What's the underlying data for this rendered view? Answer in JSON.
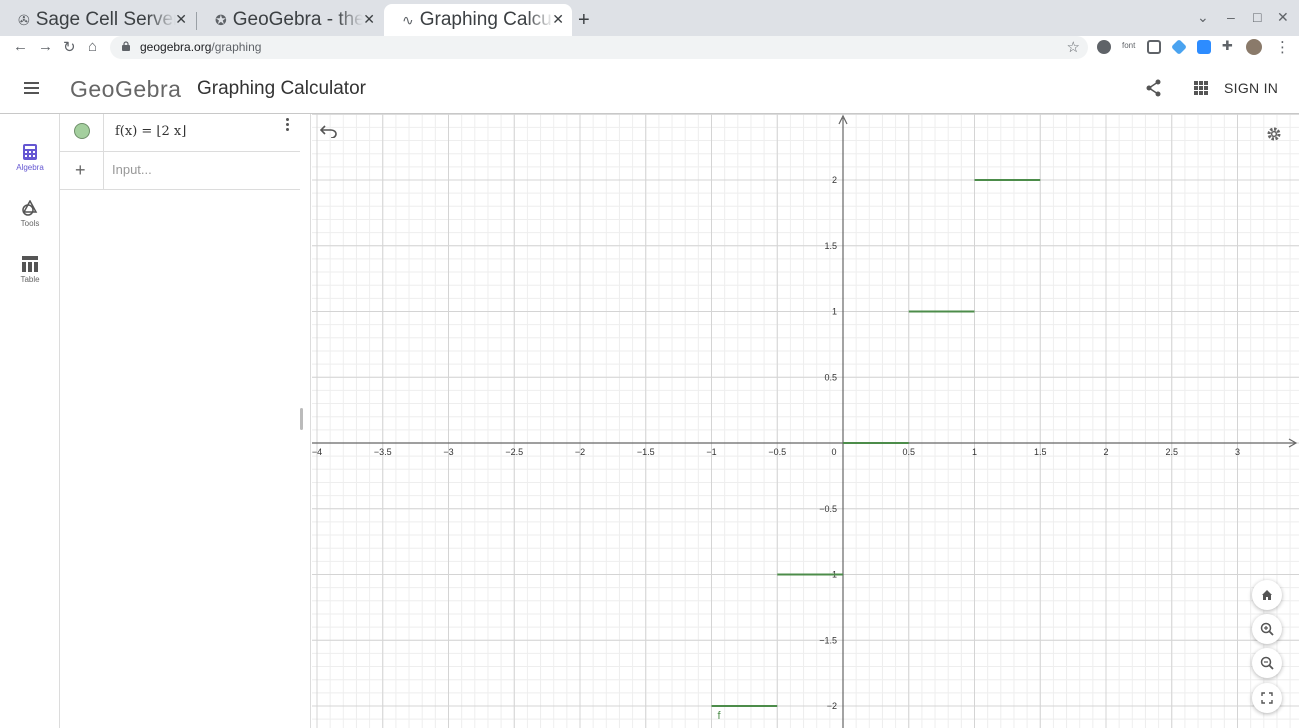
{
  "browser": {
    "tabs": [
      {
        "title": "Sage Cell Server",
        "icon": "sage-icon",
        "active": false
      },
      {
        "title": "GeoGebra - the world",
        "icon": "geogebra-icon",
        "active": false
      },
      {
        "title": "Graphing Calculator",
        "icon": "geogebra-graphing-icon",
        "active": true
      }
    ],
    "url_host": "geogebra.org",
    "url_path": "/graphing",
    "extension_labels": [
      "font"
    ]
  },
  "header": {
    "logo": "GeoGebra",
    "title": "Graphing Calculator",
    "sign_in": "SIGN IN"
  },
  "rail": {
    "items": [
      {
        "label": "Algebra",
        "icon": "calculator-icon",
        "active": true
      },
      {
        "label": "Tools",
        "icon": "tools-icon",
        "active": false
      },
      {
        "label": "Table",
        "icon": "table-icon",
        "active": false
      }
    ]
  },
  "algebra": {
    "formula": "f(x) = ⌊2 x⌋",
    "input_placeholder": "Input...",
    "marble_color": "#a4cf9e"
  },
  "graph": {
    "x_ticks": [
      "−4",
      "−3.5",
      "−3",
      "−2.5",
      "−2",
      "−1.5",
      "−1",
      "−0.5",
      "0",
      "0.5",
      "1",
      "1.5",
      "2",
      "2.5",
      "3"
    ],
    "y_ticks": [
      "2",
      "1.5",
      "1",
      "0.5",
      "−0.5",
      "−1",
      "−1.5",
      "−2"
    ],
    "function_label": "f",
    "function_color": "#4c8c4a",
    "steps": [
      {
        "x_from": -1,
        "x_to": -0.5,
        "y": -2
      },
      {
        "x_from": -0.5,
        "x_to": 0,
        "y": -1
      },
      {
        "x_from": 0,
        "x_to": 0.5,
        "y": 0
      },
      {
        "x_from": 0.5,
        "x_to": 1,
        "y": 1
      },
      {
        "x_from": 1,
        "x_to": 1.5,
        "y": 2
      }
    ]
  }
}
